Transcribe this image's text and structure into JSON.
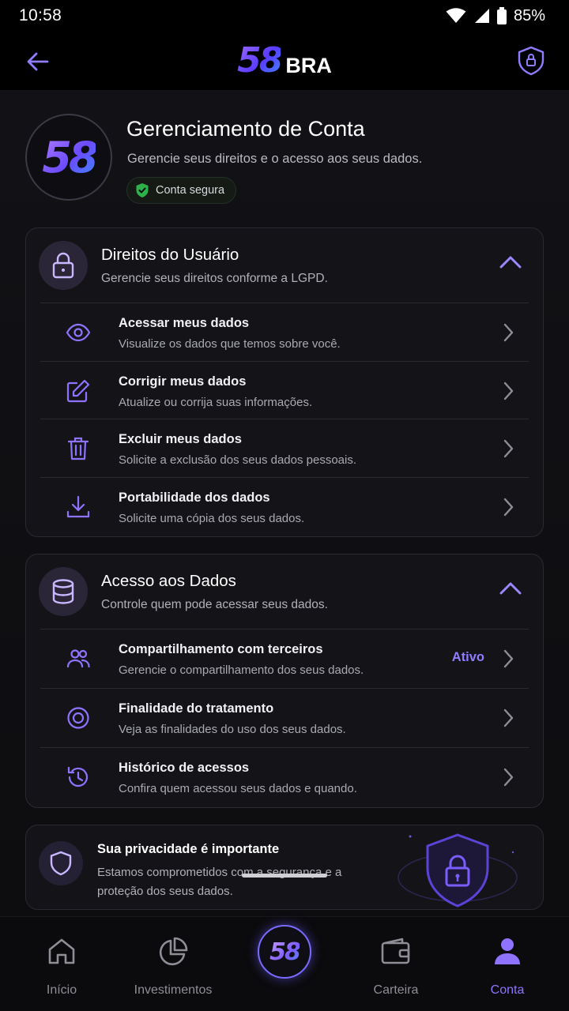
{
  "status_bar": {
    "time": "10:58",
    "battery": "85%"
  },
  "app_bar": {
    "brand_number": "58",
    "brand_text": "BRA"
  },
  "hero": {
    "logo_text": "58",
    "title": "Gerenciamento de Conta",
    "subtitle": "Gerencie seus direitos e o acesso aos seus dados.",
    "badge": "Conta segura"
  },
  "rights": {
    "title": "Direitos do Usuário",
    "subtitle": "Gerencie seus direitos conforme a LGPD.",
    "items": [
      {
        "title": "Acessar meus dados",
        "subtitle": "Visualize os dados que temos sobre você.",
        "icon": "eye-icon"
      },
      {
        "title": "Corrigir meus dados",
        "subtitle": "Atualize ou corrija suas informações.",
        "icon": "edit-icon"
      },
      {
        "title": "Excluir meus dados",
        "subtitle": "Solicite a exclusão dos seus dados pessoais.",
        "icon": "trash-icon"
      },
      {
        "title": "Portabilidade dos dados",
        "subtitle": "Solicite uma cópia dos seus dados.",
        "icon": "download-icon"
      }
    ]
  },
  "access": {
    "title": "Acesso aos Dados",
    "subtitle": "Controle quem pode acessar seus dados.",
    "items": [
      {
        "title": "Compartilhamento com terceiros",
        "subtitle": "Gerencie o compartilhamento dos seus dados.",
        "status": "Ativo",
        "icon": "users-icon"
      },
      {
        "title": "Finalidade do tratamento",
        "subtitle": "Veja as finalidades do uso dos seus dados.",
        "icon": "target-icon"
      },
      {
        "title": "Histórico de acessos",
        "subtitle": "Confira quem acessou seus dados e quando.",
        "icon": "history-icon"
      }
    ]
  },
  "privacy": {
    "title": "Sua privacidade é importante",
    "text": "Estamos comprometidos com a segurança e a proteção dos seus dados."
  },
  "bottom_nav": {
    "items": [
      {
        "label": "Início",
        "icon": "home-icon"
      },
      {
        "label": "Investimentos",
        "icon": "pie-chart-icon"
      },
      {
        "label": "Carteira",
        "icon": "wallet-icon"
      },
      {
        "label": "Conta",
        "icon": "user-icon",
        "active": true
      }
    ],
    "center_label": "58"
  },
  "colors": {
    "accent": "#8f73ff",
    "background": "#0b0b0d",
    "card": "#141418",
    "success": "#2fb14a"
  }
}
